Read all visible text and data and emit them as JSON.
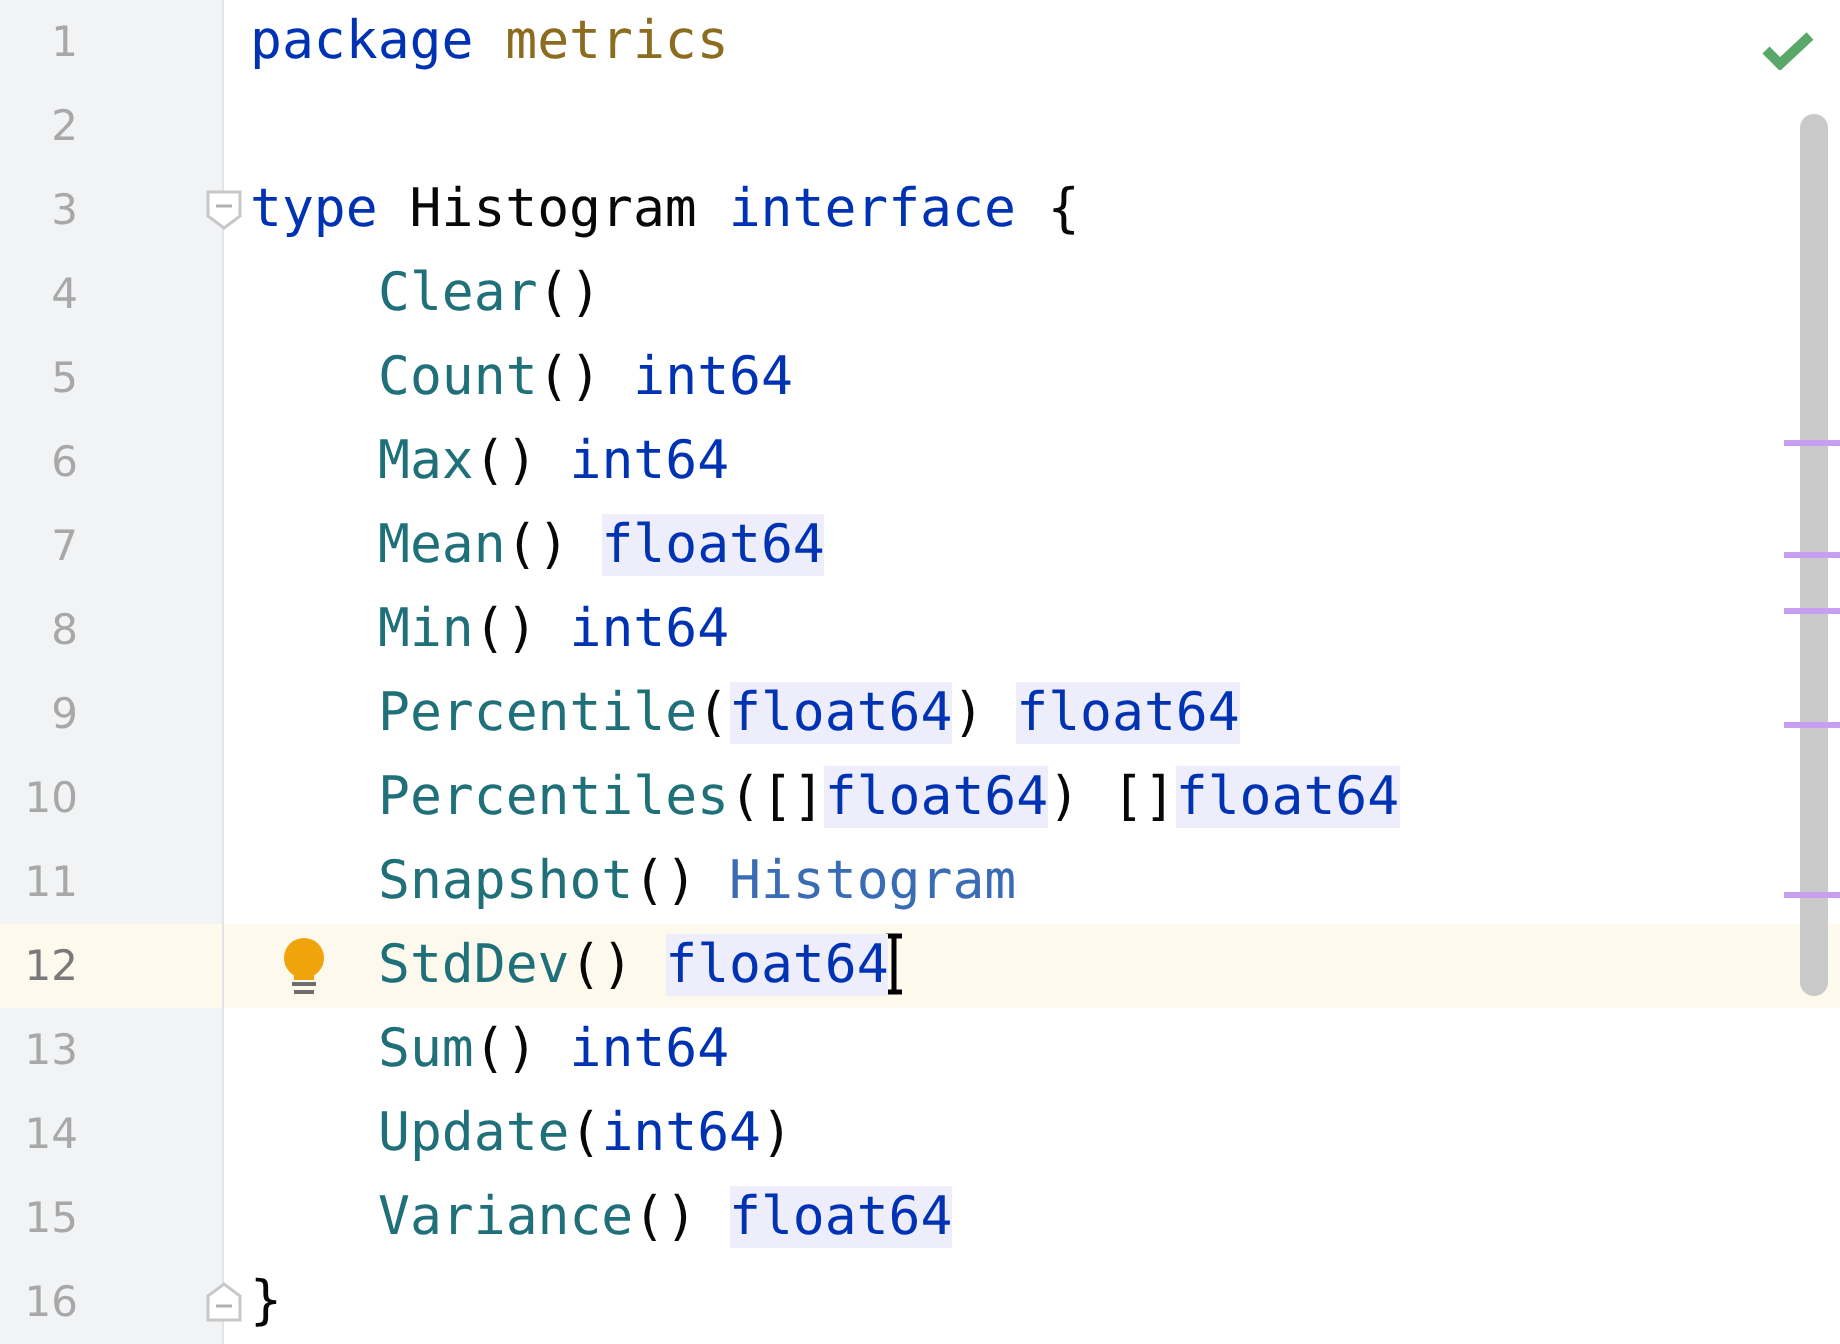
{
  "lines": [
    {
      "number": "1",
      "current": false,
      "fold": false,
      "bulb": false,
      "pointer": false,
      "tokens": [
        {
          "text": "package ",
          "kind": "keyword",
          "highlighted": false
        },
        {
          "text": "metrics",
          "kind": "package",
          "highlighted": false
        }
      ]
    },
    {
      "number": "2",
      "current": false,
      "fold": false,
      "bulb": false,
      "pointer": false
    },
    {
      "number": "3",
      "current": false,
      "fold": true,
      "bulb": false,
      "pointer": false,
      "tokens": [
        {
          "text": "type",
          "kind": "keyword",
          "highlighted": false
        },
        {
          "text": " Histogram ",
          "kind": "plain",
          "highlighted": false
        },
        {
          "text": "interface",
          "kind": "keyword",
          "highlighted": false
        },
        {
          "text": " {",
          "kind": "plain",
          "highlighted": false
        }
      ],
      "children": [
        {
          "number": "4",
          "current": false,
          "fold": false,
          "bulb": false,
          "pointer": false,
          "tokens": [
            {
              "text": "Clear",
              "kind": "method",
              "highlighted": false
            },
            {
              "text": "()",
              "kind": "plain",
              "highlighted": false
            }
          ]
        },
        {
          "number": "5",
          "current": false,
          "fold": false,
          "bulb": false,
          "pointer": false,
          "tokens": [
            {
              "text": "Count",
              "kind": "method",
              "highlighted": false
            },
            {
              "text": "() ",
              "kind": "plain",
              "highlighted": false
            },
            {
              "text": "int64",
              "kind": "keyword",
              "highlighted": false
            }
          ]
        },
        {
          "number": "6",
          "current": false,
          "fold": false,
          "bulb": false,
          "pointer": false,
          "tokens": [
            {
              "text": "Max",
              "kind": "method",
              "highlighted": false
            },
            {
              "text": "() ",
              "kind": "plain",
              "highlighted": false
            },
            {
              "text": "int64",
              "kind": "keyword",
              "highlighted": false
            }
          ]
        },
        {
          "number": "7",
          "current": false,
          "fold": false,
          "bulb": false,
          "pointer": false,
          "tokens": [
            {
              "text": "Mean",
              "kind": "method",
              "highlighted": false
            },
            {
              "text": "() ",
              "kind": "plain",
              "highlighted": false
            },
            {
              "text": "float64",
              "kind": "keyword",
              "highlighted": true
            }
          ]
        },
        {
          "number": "8",
          "current": false,
          "fold": false,
          "bulb": false,
          "pointer": false,
          "tokens": [
            {
              "text": "Min",
              "kind": "method",
              "highlighted": false
            },
            {
              "text": "() ",
              "kind": "plain",
              "highlighted": false
            },
            {
              "text": "int64",
              "kind": "keyword",
              "highlighted": false
            }
          ]
        },
        {
          "number": "9",
          "current": false,
          "fold": false,
          "bulb": false,
          "pointer": false,
          "tokens": [
            {
              "text": "Percentile",
              "kind": "method",
              "highlighted": false
            },
            {
              "text": "(",
              "kind": "plain",
              "highlighted": false
            },
            {
              "text": "float64",
              "kind": "keyword",
              "highlighted": true
            },
            {
              "text": ") ",
              "kind": "plain",
              "highlighted": false
            },
            {
              "text": "float64",
              "kind": "keyword",
              "highlighted": true
            }
          ]
        },
        {
          "number": "10",
          "current": false,
          "fold": false,
          "bulb": false,
          "pointer": false,
          "tokens": [
            {
              "text": "Percentiles",
              "kind": "method",
              "highlighted": false
            },
            {
              "text": "([]",
              "kind": "plain",
              "highlighted": false
            },
            {
              "text": "float64",
              "kind": "keyword",
              "highlighted": true
            },
            {
              "text": ") []",
              "kind": "plain",
              "highlighted": false
            },
            {
              "text": "float64",
              "kind": "keyword",
              "highlighted": true
            }
          ]
        },
        {
          "number": "11",
          "current": false,
          "fold": false,
          "bulb": false,
          "pointer": false,
          "tokens": [
            {
              "text": "Snapshot",
              "kind": "method",
              "highlighted": false
            },
            {
              "text": "() ",
              "kind": "plain",
              "highlighted": false
            },
            {
              "text": "Histogram",
              "kind": "type_ref",
              "highlighted": false
            }
          ]
        },
        {
          "number": "12",
          "current": true,
          "fold": false,
          "bulb": true,
          "pointer": true,
          "tokens": [
            {
              "text": "StdDev",
              "kind": "method",
              "highlighted": false
            },
            {
              "text": "() ",
              "kind": "plain",
              "highlighted": false
            },
            {
              "text": "float64",
              "kind": "keyword",
              "highlighted": true
            }
          ]
        },
        {
          "number": "13",
          "current": false,
          "fold": false,
          "bulb": false,
          "pointer": false,
          "tokens": [
            {
              "text": "Sum",
              "kind": "method",
              "highlighted": false
            },
            {
              "text": "() ",
              "kind": "plain",
              "highlighted": false
            },
            {
              "text": "int64",
              "kind": "keyword",
              "highlighted": false
            }
          ]
        },
        {
          "number": "14",
          "current": false,
          "fold": false,
          "bulb": false,
          "pointer": false,
          "tokens": [
            {
              "text": "Update",
              "kind": "method",
              "highlighted": false
            },
            {
              "text": "(",
              "kind": "plain",
              "highlighted": false
            },
            {
              "text": "int64",
              "kind": "keyword",
              "highlighted": false
            },
            {
              "text": ")",
              "kind": "plain",
              "highlighted": false
            }
          ]
        },
        {
          "number": "15",
          "current": false,
          "fold": false,
          "bulb": false,
          "pointer": false,
          "tokens": [
            {
              "text": "Variance",
              "kind": "method",
              "highlighted": false
            },
            {
              "text": "() ",
              "kind": "plain",
              "highlighted": false
            },
            {
              "text": "float64",
              "kind": "keyword",
              "highlighted": true
            }
          ]
        }
      ]
    },
    {
      "number": "16",
      "current": false,
      "fold": true,
      "bulb": false,
      "pointer": false,
      "tokens": [
        {
          "text": "}",
          "kind": "plain",
          "highlighted": false
        }
      ]
    }
  ]
}
